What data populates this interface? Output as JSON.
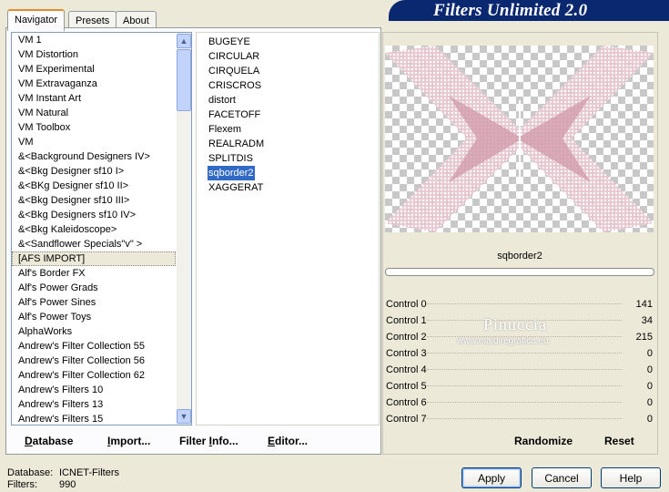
{
  "tabs": [
    {
      "label": "Navigator",
      "active": true
    },
    {
      "label": "Presets",
      "active": false
    },
    {
      "label": "About",
      "active": false
    }
  ],
  "header": {
    "title": "Filters Unlimited 2.0"
  },
  "categories": {
    "items": [
      "VM 1",
      "VM Distortion",
      "VM Experimental",
      "VM Extravaganza",
      "VM Instant Art",
      "VM Natural",
      "VM Toolbox",
      "VM",
      "&<Background Designers IV>",
      "&<Bkg Designer sf10 I>",
      "&<BKg Designer sf10 II>",
      "&<Bkg Designer sf10 III>",
      "&<Bkg Designers sf10 IV>",
      "&<Bkg Kaleidoscope>",
      "&<Sandflower Specials\"v\" >",
      "[AFS IMPORT]",
      "Alf's Border FX",
      "Alf's Power Grads",
      "Alf's Power Sines",
      "Alf's Power Toys",
      "AlphaWorks",
      "Andrew's Filter Collection 55",
      "Andrew's Filter Collection 56",
      "Andrew's Filter Collection 62",
      "Andrew's Filters 10",
      "Andrew's Filters 13",
      "Andrew's Filters 15"
    ],
    "selected": "[AFS IMPORT]"
  },
  "filters": {
    "items": [
      "BUGEYE",
      "CIRCULAR",
      "CIRQUELA",
      "CRISCROS",
      "distort",
      "FACETOFF",
      "Flexem",
      "REALRADM",
      "SPLITDIS",
      "sqborder2",
      "XAGGERAT"
    ],
    "selected": "sqborder2"
  },
  "left_buttons": [
    {
      "pre": "",
      "u": "D",
      "post": "atabase"
    },
    {
      "pre": "",
      "u": "I",
      "post": "mport..."
    },
    {
      "pre": "Filter ",
      "u": "I",
      "post": "nfo..."
    },
    {
      "pre": "",
      "u": "E",
      "post": "ditor..."
    }
  ],
  "preview": {
    "filter_name": "sqborder2",
    "progress": 0,
    "accent_color": "#d4a0ae"
  },
  "controls": [
    {
      "name": "Control 0",
      "value": "141"
    },
    {
      "name": "Control 1",
      "value": "34"
    },
    {
      "name": "Control 2",
      "value": "215"
    },
    {
      "name": "Control 3",
      "value": "0"
    },
    {
      "name": "Control 4",
      "value": "0"
    },
    {
      "name": "Control 5",
      "value": "0"
    },
    {
      "name": "Control 6",
      "value": "0"
    },
    {
      "name": "Control 7",
      "value": "0"
    }
  ],
  "watermark": {
    "name": "Pinuccia",
    "url": "www.maidiregrafica.eu"
  },
  "right_buttons": {
    "randomize": "Randomize",
    "reset": "Reset"
  },
  "footer": {
    "database_label": "Database:",
    "database_value": "ICNET-Filters",
    "filters_label": "Filters:",
    "filters_value": "990"
  },
  "dialog_buttons": {
    "apply": "Apply",
    "cancel": "Cancel",
    "help": "Help"
  },
  "icons": {
    "scroll_up": "scroll-up-arrow-icon",
    "scroll_down": "scroll-down-arrow-icon"
  }
}
